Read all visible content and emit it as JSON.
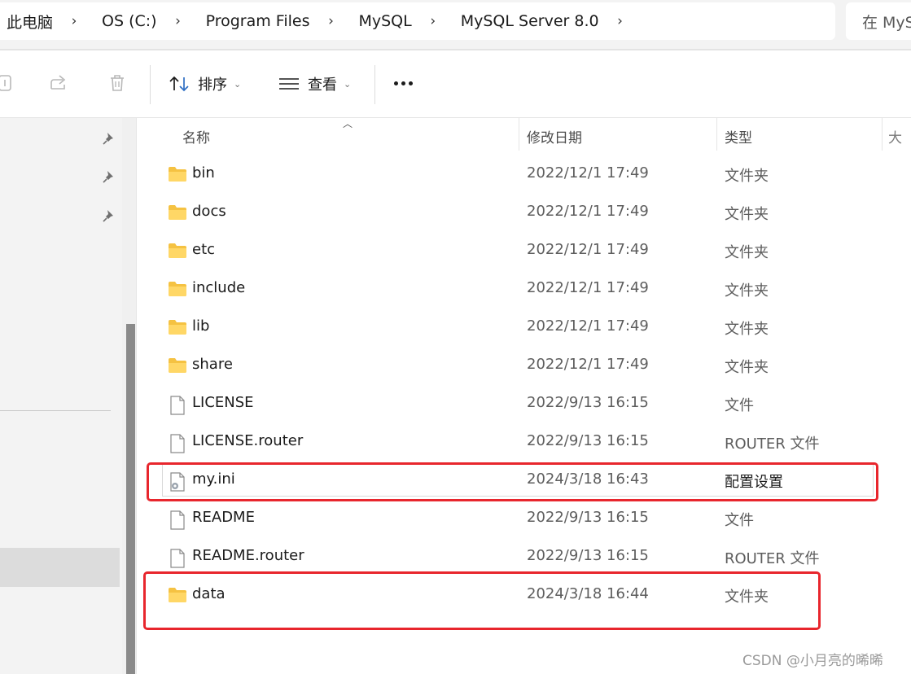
{
  "address_bar": {
    "crumbs": [
      "此电脑",
      "OS (C:)",
      "Program Files",
      "MySQL",
      "MySQL Server 8.0"
    ],
    "separator": "›",
    "search_placeholder": "在 MyS"
  },
  "toolbar": {
    "sort_label": "排序",
    "view_label": "查看",
    "chevron": "⌄",
    "icons": [
      "copy-icon",
      "share-icon",
      "delete-icon",
      "sort-icon",
      "view-icon",
      "more-icon"
    ]
  },
  "columns": {
    "name": "名称",
    "date": "修改日期",
    "type": "类型",
    "size": "大"
  },
  "files": [
    {
      "name": "bin",
      "date": "2022/12/1 17:49",
      "type": "文件夹",
      "kind": "folder"
    },
    {
      "name": "docs",
      "date": "2022/12/1 17:49",
      "type": "文件夹",
      "kind": "folder"
    },
    {
      "name": "etc",
      "date": "2022/12/1 17:49",
      "type": "文件夹",
      "kind": "folder"
    },
    {
      "name": "include",
      "date": "2022/12/1 17:49",
      "type": "文件夹",
      "kind": "folder"
    },
    {
      "name": "lib",
      "date": "2022/12/1 17:49",
      "type": "文件夹",
      "kind": "folder"
    },
    {
      "name": "share",
      "date": "2022/12/1 17:49",
      "type": "文件夹",
      "kind": "folder"
    },
    {
      "name": "LICENSE",
      "date": "2022/9/13 16:15",
      "type": "文件",
      "kind": "file"
    },
    {
      "name": "LICENSE.router",
      "date": "2022/9/13 16:15",
      "type": "ROUTER 文件",
      "kind": "file"
    },
    {
      "name": "my.ini",
      "date": "2024/3/18 16:43",
      "type": "配置设置",
      "kind": "config"
    },
    {
      "name": "README",
      "date": "2022/9/13 16:15",
      "type": "文件",
      "kind": "file"
    },
    {
      "name": "README.router",
      "date": "2022/9/13 16:15",
      "type": "ROUTER 文件",
      "kind": "file"
    },
    {
      "name": "data",
      "date": "2024/3/18 16:44",
      "type": "文件夹",
      "kind": "folder"
    }
  ],
  "annotations": {
    "highlight_color": "#e8262d",
    "highlighted_rows": [
      "my.ini",
      "data"
    ]
  },
  "watermark": "CSDN @小月亮的晞晞"
}
